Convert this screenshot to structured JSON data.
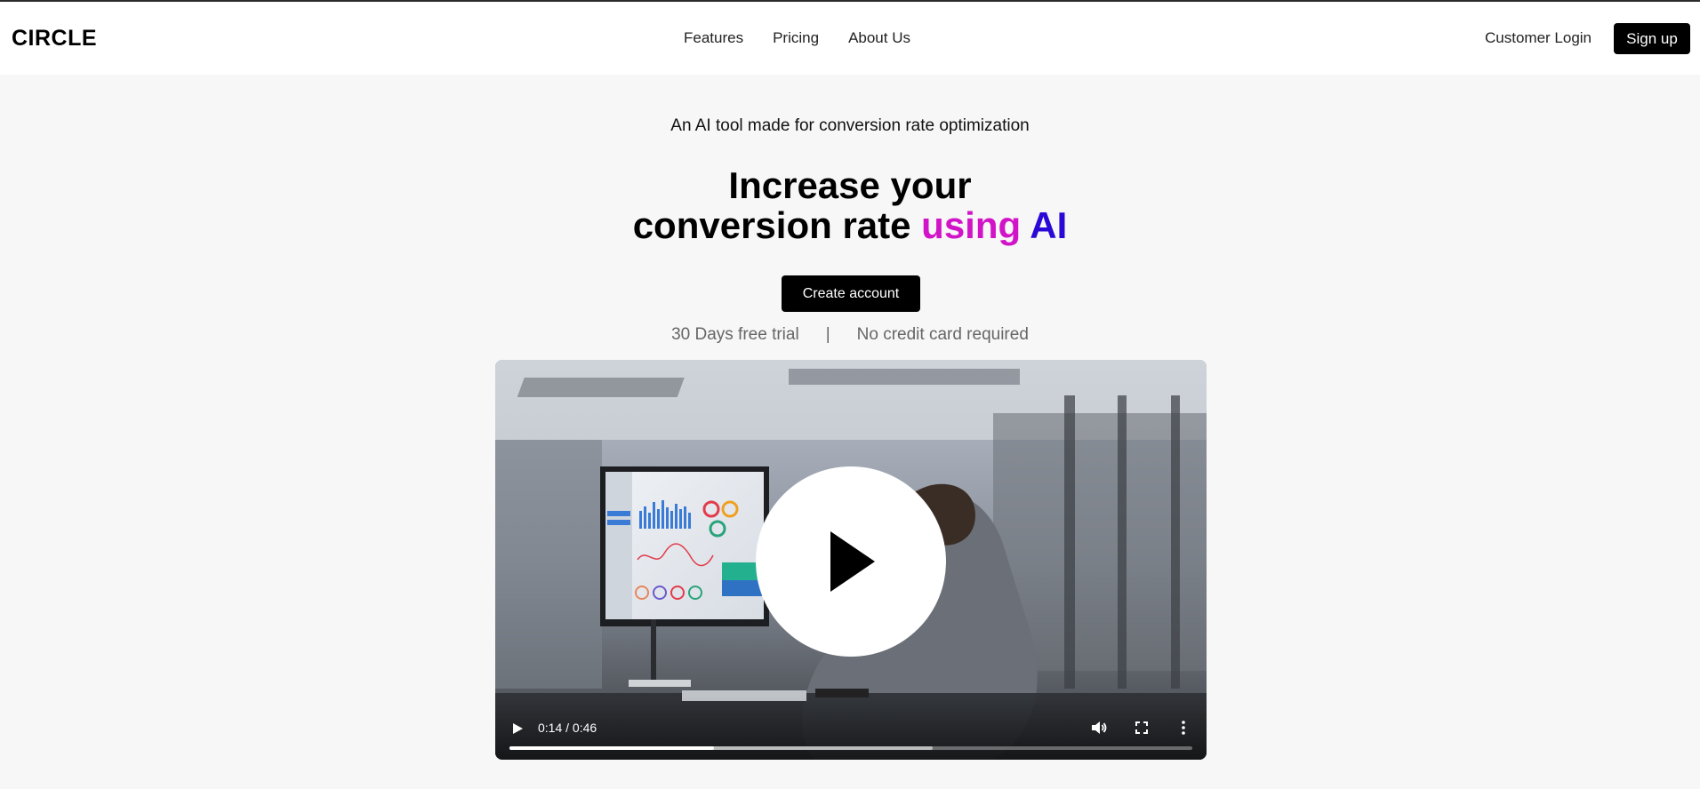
{
  "header": {
    "logo": "CIRCLE",
    "nav": [
      "Features",
      "Pricing",
      "About Us"
    ],
    "login_label": "Customer Login",
    "signup_label": "Sign up"
  },
  "hero": {
    "tagline": "An AI tool made for conversion rate optimization",
    "headline_line1": "Increase your",
    "headline_line2_plain": "conversion rate",
    "headline_using": "using",
    "headline_ai": "AI",
    "cta_label": "Create account",
    "trial_left": "30 Days free trial",
    "trial_sep": "|",
    "trial_right": "No credit card required",
    "colors": {
      "using": "#d214c8",
      "ai": "#2a08d6"
    }
  },
  "video": {
    "time_display": "0:14 / 0:46",
    "progress_fraction": 0.3,
    "buffered_fraction": 0.62,
    "icons": [
      "play-icon",
      "volume-icon",
      "fullscreen-icon",
      "more-options-icon",
      "big-play-icon"
    ]
  }
}
